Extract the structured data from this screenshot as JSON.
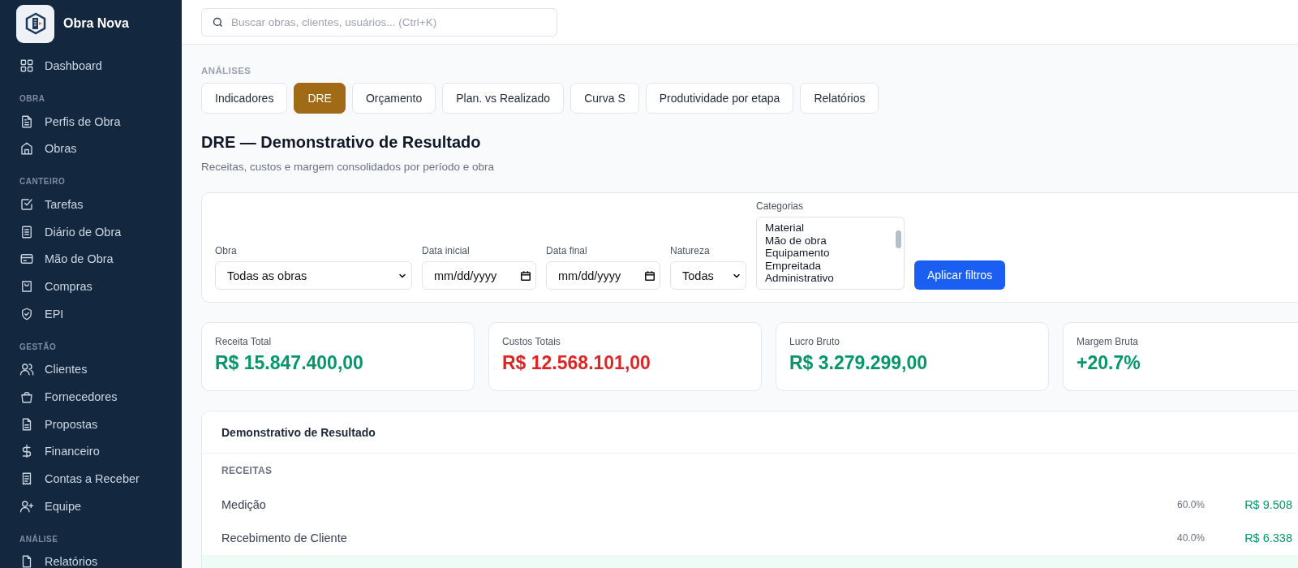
{
  "sidebar": {
    "brand": "Obra Nova",
    "sections": [
      {
        "items": [
          {
            "label": "Dashboard"
          }
        ]
      },
      {
        "title": "OBRA",
        "items": [
          {
            "label": "Perfis de Obra"
          },
          {
            "label": "Obras"
          }
        ]
      },
      {
        "title": "CANTEIRO",
        "items": [
          {
            "label": "Tarefas"
          },
          {
            "label": "Diário de Obra"
          },
          {
            "label": "Mão de Obra"
          },
          {
            "label": "Compras"
          },
          {
            "label": "EPI"
          }
        ]
      },
      {
        "title": "GESTÃO",
        "items": [
          {
            "label": "Clientes"
          },
          {
            "label": "Fornecedores"
          },
          {
            "label": "Propostas"
          },
          {
            "label": "Financeiro"
          },
          {
            "label": "Contas a Receber"
          },
          {
            "label": "Equipe"
          }
        ]
      },
      {
        "title": "ANÁLISE",
        "items": [
          {
            "label": "Relatórios"
          }
        ]
      }
    ]
  },
  "search": {
    "placeholder": "Buscar obras, clientes, usuários... (Ctrl+K)"
  },
  "section_label": "ANÁLISES",
  "tabs": [
    {
      "label": "Indicadores",
      "selected": false
    },
    {
      "label": "DRE",
      "selected": true
    },
    {
      "label": "Orçamento",
      "selected": false
    },
    {
      "label": "Plan. vs Realizado",
      "selected": false
    },
    {
      "label": "Curva S",
      "selected": false
    },
    {
      "label": "Produtividade por etapa",
      "selected": false
    },
    {
      "label": "Relatórios",
      "selected": false
    }
  ],
  "page": {
    "title": "DRE — Demonstrativo de Resultado",
    "subtitle": "Receitas, custos e margem consolidados por período e obra"
  },
  "filters": {
    "obra": {
      "label": "Obra",
      "value": "Todas as obras"
    },
    "data_inicial": {
      "label": "Data inicial",
      "value": "mm/dd/yyyy"
    },
    "data_final": {
      "label": "Data final",
      "value": "mm/dd/yyyy"
    },
    "natureza": {
      "label": "Natureza",
      "value": "Todas"
    },
    "categorias": {
      "label": "Categorias",
      "options": [
        "Material",
        "Mão de obra",
        "Equipamento",
        "Empreitada",
        "Administrativo"
      ]
    },
    "apply_button": "Aplicar filtros"
  },
  "kpis": [
    {
      "label": "Receita Total",
      "value": "R$ 15.847.400,00",
      "color": "#059669"
    },
    {
      "label": "Custos Totais",
      "value": "R$ 12.568.101,00",
      "color": "#dc2626"
    },
    {
      "label": "Lucro Bruto",
      "value": "R$ 3.279.299,00",
      "color": "#059669"
    },
    {
      "label": "Margem Bruta",
      "value": "+20.7%",
      "color": "#059669"
    }
  ],
  "statement": {
    "title": "Demonstrativo de Resultado",
    "group": "RECEITAS",
    "rows": [
      {
        "label": "Medição",
        "percent": "60.0%",
        "value": "R$ 9.508"
      },
      {
        "label": "Recebimento de Cliente",
        "percent": "40.0%",
        "value": "R$ 6.338"
      }
    ]
  }
}
